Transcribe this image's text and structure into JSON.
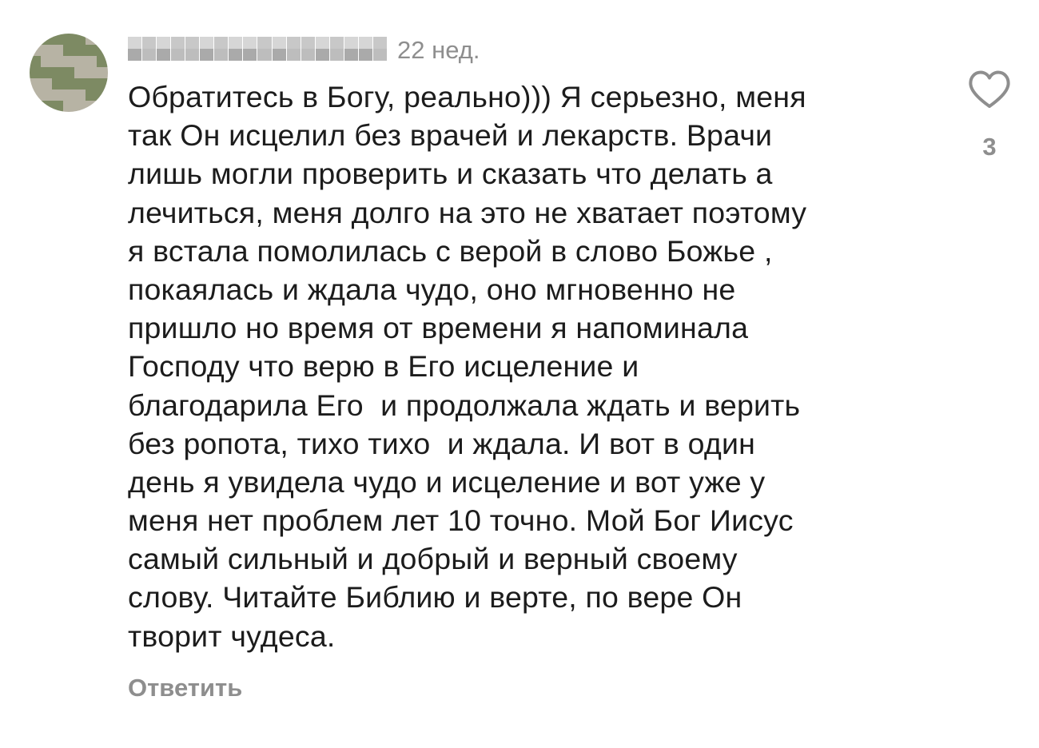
{
  "comment": {
    "username": "",
    "timestamp": "22 нед.",
    "text_lines": [
      "Обратитесь в Богу, реально))) Я серьезно, меня",
      "так Он исцелил без врачей и лекарств. Врачи",
      "лишь могли проверить и сказать что делать а",
      "лечиться, меня долго на это не хватает поэтому",
      "я встала помолилась с верой в слово Божье ,",
      "покаялась и ждала чудо, оно мгновенно не",
      "пришло но время от времени я напоминала",
      "Господу что верю в Его исцеление и",
      "благодарила Его  и продолжала ждать и верить",
      "без ропота, тихо тихо  и ждала. И вот в один",
      "день я увидела чудо и исцеление и вот уже у",
      "меня нет проблем лет 10 точно. Мой Бог Иисус",
      "самый сильный и добрый и верный своему",
      "слову. Читайте Библию и верте, по вере Он",
      "творит чудеса."
    ],
    "reply_label": "Ответить",
    "like_icon": "heart-outline-icon",
    "like_count": "3"
  },
  "colors": {
    "text": "#1c1c1c",
    "meta": "#8e8e8e",
    "background": "#ffffff"
  }
}
